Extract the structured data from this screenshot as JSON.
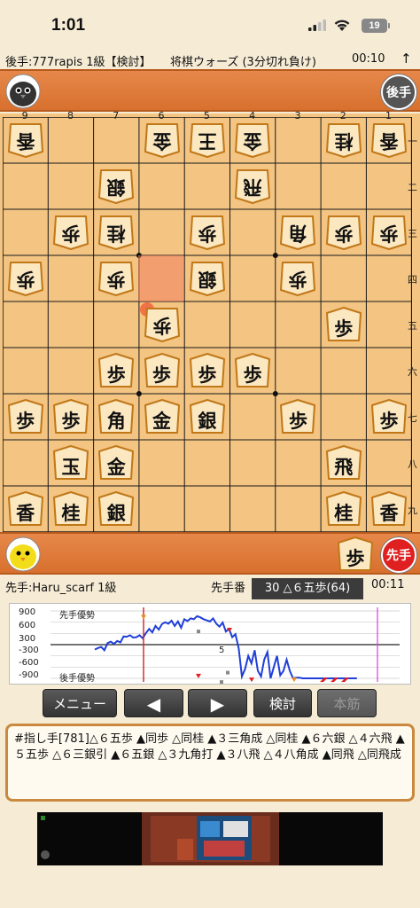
{
  "status_bar": {
    "time": "1:01",
    "battery": "19"
  },
  "game_info": {
    "gote_player": "後手:777rapis 1級【検討】",
    "rule": "将棋ウォーズ (3分切れ負け)",
    "gote_time": "00:10",
    "arrow": "↑"
  },
  "gote_badge": "後手",
  "sente_badge": "先手",
  "file_labels": [
    "9",
    "8",
    "7",
    "6",
    "5",
    "4",
    "3",
    "2",
    "1"
  ],
  "rank_labels": [
    "一",
    "二",
    "三",
    "四",
    "五",
    "六",
    "七",
    "八",
    "九"
  ],
  "pieces": [
    {
      "f": 9,
      "r": 1,
      "ch": "香",
      "side": "gote"
    },
    {
      "f": 6,
      "r": 1,
      "ch": "金",
      "side": "gote"
    },
    {
      "f": 5,
      "r": 1,
      "ch": "王",
      "side": "gote"
    },
    {
      "f": 4,
      "r": 1,
      "ch": "金",
      "side": "gote"
    },
    {
      "f": 2,
      "r": 1,
      "ch": "桂",
      "side": "gote"
    },
    {
      "f": 1,
      "r": 1,
      "ch": "香",
      "side": "gote"
    },
    {
      "f": 7,
      "r": 2,
      "ch": "銀",
      "side": "gote"
    },
    {
      "f": 4,
      "r": 2,
      "ch": "飛",
      "side": "gote"
    },
    {
      "f": 8,
      "r": 3,
      "ch": "歩",
      "side": "gote"
    },
    {
      "f": 7,
      "r": 3,
      "ch": "桂",
      "side": "gote"
    },
    {
      "f": 5,
      "r": 3,
      "ch": "歩",
      "side": "gote"
    },
    {
      "f": 3,
      "r": 3,
      "ch": "角",
      "side": "gote"
    },
    {
      "f": 2,
      "r": 3,
      "ch": "歩",
      "side": "gote"
    },
    {
      "f": 1,
      "r": 3,
      "ch": "歩",
      "side": "gote"
    },
    {
      "f": 9,
      "r": 4,
      "ch": "歩",
      "side": "gote"
    },
    {
      "f": 7,
      "r": 4,
      "ch": "歩",
      "side": "gote"
    },
    {
      "f": 5,
      "r": 4,
      "ch": "銀",
      "side": "gote"
    },
    {
      "f": 3,
      "r": 4,
      "ch": "歩",
      "side": "gote"
    },
    {
      "f": 6,
      "r": 5,
      "ch": "歩",
      "side": "gote"
    },
    {
      "f": 2,
      "r": 5,
      "ch": "歩",
      "side": "sente"
    },
    {
      "f": 7,
      "r": 6,
      "ch": "歩",
      "side": "sente"
    },
    {
      "f": 6,
      "r": 6,
      "ch": "歩",
      "side": "sente"
    },
    {
      "f": 5,
      "r": 6,
      "ch": "歩",
      "side": "sente"
    },
    {
      "f": 4,
      "r": 6,
      "ch": "歩",
      "side": "sente"
    },
    {
      "f": 9,
      "r": 7,
      "ch": "歩",
      "side": "sente"
    },
    {
      "f": 8,
      "r": 7,
      "ch": "歩",
      "side": "sente"
    },
    {
      "f": 7,
      "r": 7,
      "ch": "角",
      "side": "sente"
    },
    {
      "f": 6,
      "r": 7,
      "ch": "金",
      "side": "sente"
    },
    {
      "f": 5,
      "r": 7,
      "ch": "銀",
      "side": "sente"
    },
    {
      "f": 3,
      "r": 7,
      "ch": "歩",
      "side": "sente"
    },
    {
      "f": 1,
      "r": 7,
      "ch": "歩",
      "side": "sente"
    },
    {
      "f": 8,
      "r": 8,
      "ch": "玉",
      "side": "sente"
    },
    {
      "f": 7,
      "r": 8,
      "ch": "金",
      "side": "sente"
    },
    {
      "f": 2,
      "r": 8,
      "ch": "飛",
      "side": "sente"
    },
    {
      "f": 9,
      "r": 9,
      "ch": "香",
      "side": "sente"
    },
    {
      "f": 8,
      "r": 9,
      "ch": "桂",
      "side": "sente"
    },
    {
      "f": 7,
      "r": 9,
      "ch": "銀",
      "side": "sente"
    },
    {
      "f": 2,
      "r": 9,
      "ch": "桂",
      "side": "sente"
    },
    {
      "f": 1,
      "r": 9,
      "ch": "香",
      "side": "sente"
    }
  ],
  "sente_hand": [
    {
      "ch": "歩"
    }
  ],
  "sente_info": {
    "player": "先手:Haru_scarf 1級",
    "turn_label": "先手番",
    "move": "30 △６五歩(64)",
    "time": "00:11"
  },
  "graph": {
    "labels": {
      "y900": "900",
      "y600": "600",
      "y300": "300",
      "ym300": "-300",
      "ym600": "-600",
      "ym900": "-900",
      "top": "先手優勢",
      "bottom": "後手優勢",
      "mark5": "5"
    },
    "ylim": [
      -900,
      900
    ],
    "values": [
      -130,
      -90,
      -60,
      -150,
      40,
      80,
      20,
      100,
      60,
      220,
      210,
      250,
      190,
      200,
      250,
      170,
      310,
      420,
      330,
      500,
      400,
      550,
      600,
      560,
      640,
      500,
      620,
      450,
      680,
      630,
      700,
      680,
      760,
      730,
      680,
      650,
      620,
      700,
      560,
      480,
      590,
      350,
      420,
      200,
      280,
      -100,
      -850,
      -650,
      -300,
      -500,
      -150,
      -700,
      -850,
      -400,
      -200,
      -900,
      -600,
      -300,
      -820,
      -700,
      -400,
      -700,
      -900,
      -880,
      -880,
      -900,
      -950,
      -950,
      -950,
      -950,
      -950,
      -950,
      -950,
      -950,
      -950,
      -950,
      -950,
      -950,
      -950,
      -950,
      -950,
      -950,
      -950
    ]
  },
  "buttons": {
    "menu": "メニュー",
    "prev": "◀",
    "next": "▶",
    "analyze": "検討",
    "honsuji": "本筋"
  },
  "kifu_text": "#指し手[781]△６五歩 ▲同歩 △同桂 ▲３三角成 △同桂 ▲６六銀 △４六飛 ▲５五歩 △６三銀引 ▲６五銀 △３九角打 ▲３八飛 △４八角成 ▲同飛 △同飛成"
}
